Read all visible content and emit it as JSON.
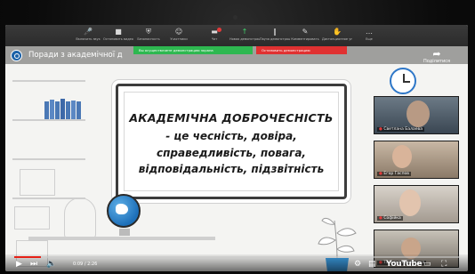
{
  "zoom_toolbar": {
    "items": [
      {
        "label": "Включить звук",
        "icon": "microphone-icon",
        "glyph": "🎤"
      },
      {
        "label": "Остановить видео",
        "icon": "video-camera-icon",
        "glyph": "■"
      },
      {
        "label": "Безопасность",
        "icon": "shield-icon",
        "glyph": "⛨"
      },
      {
        "label": "Участники",
        "icon": "participants-icon",
        "glyph": "☺"
      },
      {
        "label": "Чат",
        "icon": "chat-icon",
        "glyph": "▬"
      },
      {
        "label": "Новая демонстрация",
        "icon": "share-screen-icon",
        "glyph": "↑"
      },
      {
        "label": "Пауза демонстрации",
        "icon": "pause-icon",
        "glyph": "‖"
      },
      {
        "label": "Комментировать",
        "icon": "annotate-icon",
        "glyph": "✎"
      },
      {
        "label": "Дистанционное управление",
        "icon": "remote-control-icon",
        "glyph": "✋"
      },
      {
        "label": "Еще",
        "icon": "more-icon",
        "glyph": "…"
      }
    ],
    "chat_badge": "",
    "green_item_index": 5
  },
  "share_banner": {
    "green_text": "Вы осуществляете демонстрацию экрана",
    "red_text": "Остановить демонстрацию"
  },
  "youtube": {
    "title": "Поради з академічної д",
    "share_label": "Поділитися",
    "share_icon": "share-arrow-icon",
    "time": "0:09 / 2:26",
    "progress": 0.06,
    "brand": "YouTube"
  },
  "board": {
    "line1": "АКАДЕМІЧНА ДОБРОЧЕСНІСТЬ",
    "line2": "- це чесність, довіра,",
    "line3": "справедливість, повага,",
    "line4": "відповідальність, підзвітність"
  },
  "participants": [
    {
      "name": "Светлана Балаева"
    },
    {
      "name": "Егор Гаспов"
    },
    {
      "name": "Софійка"
    },
    {
      "name": "Татьяна Кочергина"
    }
  ],
  "colors": {
    "zoom_green": "#2eb850",
    "zoom_red": "#e03131",
    "youtube_red": "#e62117",
    "globe_blue": "#1d6fb8",
    "pot_blue": "#3b9be0"
  }
}
